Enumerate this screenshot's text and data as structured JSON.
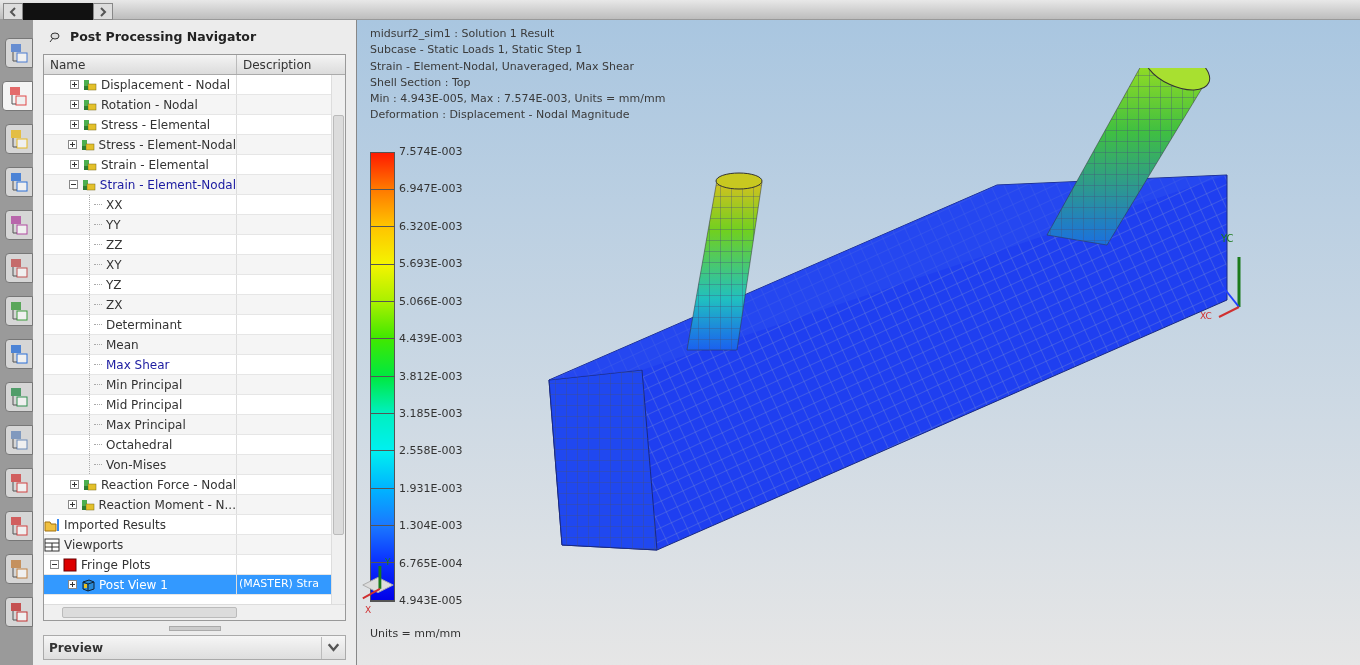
{
  "side_tabs": [
    {
      "selected": false
    },
    {
      "selected": true
    },
    {
      "selected": false
    },
    {
      "selected": false
    },
    {
      "selected": false
    },
    {
      "selected": false
    },
    {
      "selected": false
    },
    {
      "selected": false
    },
    {
      "selected": false
    },
    {
      "selected": false
    },
    {
      "selected": false
    },
    {
      "selected": false
    },
    {
      "selected": false
    },
    {
      "selected": false
    }
  ],
  "navigator": {
    "title": "Post Processing Navigator",
    "columns": [
      "Name",
      "Description"
    ],
    "result_types": [
      {
        "label": "Displacement - Nodal",
        "expanded": false,
        "highlighted": false
      },
      {
        "label": "Rotation - Nodal",
        "expanded": false,
        "highlighted": false
      },
      {
        "label": "Stress - Elemental",
        "expanded": false,
        "highlighted": false
      },
      {
        "label": "Stress - Element-Nodal",
        "expanded": false,
        "highlighted": false
      },
      {
        "label": "Strain - Elemental",
        "expanded": false,
        "highlighted": false
      },
      {
        "label": "Strain - Element-Nodal",
        "expanded": true,
        "highlighted": true,
        "children": [
          {
            "label": "XX",
            "highlighted": false
          },
          {
            "label": "YY",
            "highlighted": false
          },
          {
            "label": "ZZ",
            "highlighted": false
          },
          {
            "label": "XY",
            "highlighted": false
          },
          {
            "label": "YZ",
            "highlighted": false
          },
          {
            "label": "ZX",
            "highlighted": false
          },
          {
            "label": "Determinant",
            "highlighted": false
          },
          {
            "label": "Mean",
            "highlighted": false
          },
          {
            "label": "Max Shear",
            "highlighted": true
          },
          {
            "label": "Min Principal",
            "highlighted": false
          },
          {
            "label": "Mid Principal",
            "highlighted": false
          },
          {
            "label": "Max Principal",
            "highlighted": false
          },
          {
            "label": "Octahedral",
            "highlighted": false
          },
          {
            "label": "Von-Mises",
            "highlighted": false
          }
        ]
      },
      {
        "label": "Reaction Force - Nodal",
        "expanded": false,
        "highlighted": false
      },
      {
        "label": "Reaction Moment - N...",
        "expanded": false,
        "highlighted": false
      }
    ],
    "root_items": [
      {
        "kind": "imported",
        "label": "Imported Results"
      },
      {
        "kind": "viewports",
        "label": "Viewports"
      },
      {
        "kind": "fringe",
        "label": "Fringe Plots",
        "expanded": true,
        "children": [
          {
            "label": "Post View 1",
            "description": "(MASTER) Stra",
            "selected": true
          }
        ]
      }
    ],
    "preview": "Preview"
  },
  "viewport": {
    "info_lines": [
      "midsurf2_sim1 : Solution 1 Result",
      "Subcase - Static Loads 1, Static Step 1",
      "Strain - Element-Nodal, Unaveraged, Max Shear",
      "Shell Section : Top",
      "Min : 4.943E-005, Max : 7.574E-003, Units = mm/mm",
      "Deformation : Displacement - Nodal Magnitude"
    ],
    "legend": [
      "7.574E-003",
      "6.947E-003",
      "6.320E-003",
      "5.693E-003",
      "5.066E-003",
      "4.439E-003",
      "3.812E-003",
      "3.185E-003",
      "2.558E-003",
      "1.931E-003",
      "1.304E-003",
      "6.765E-004",
      "4.943E-005"
    ],
    "units": "Units = mm/mm",
    "triad": {
      "y": "YC",
      "x": "XC"
    },
    "small_triad": {
      "y": "Y",
      "x": "X"
    }
  }
}
